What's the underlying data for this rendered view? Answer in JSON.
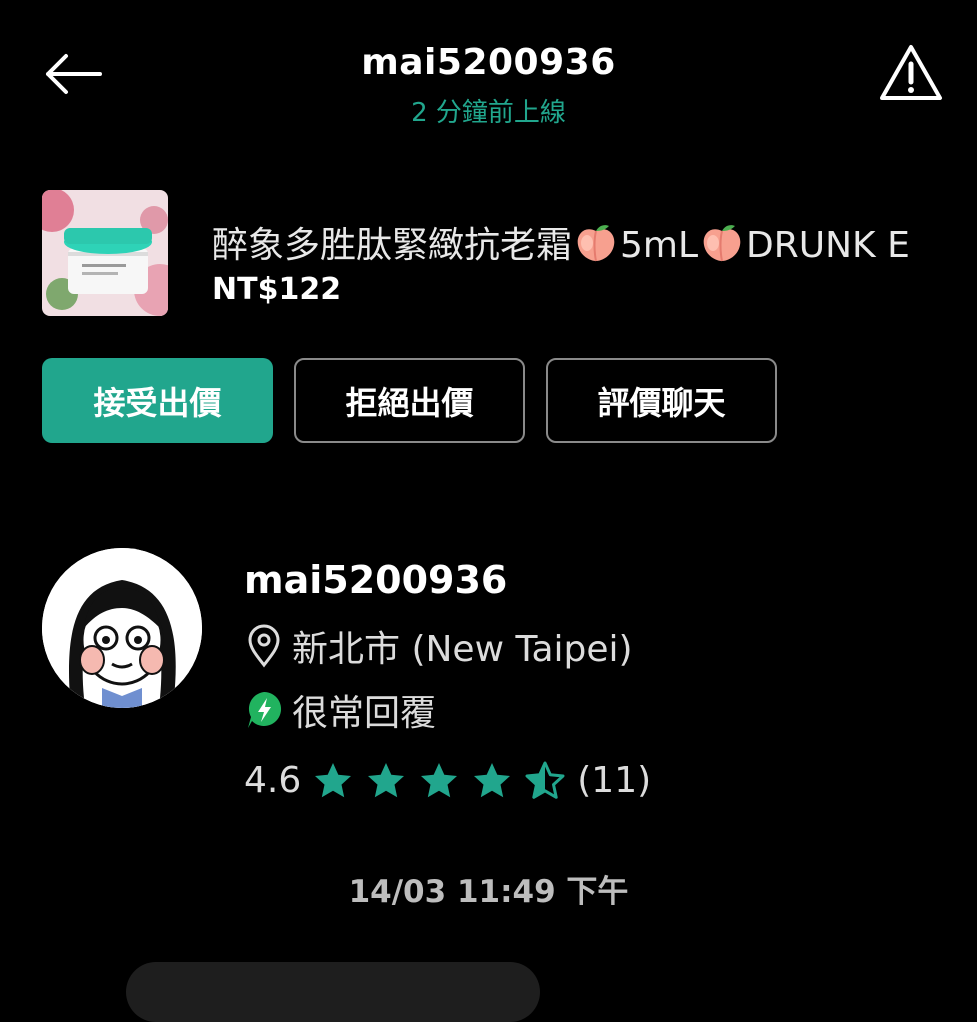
{
  "header": {
    "username": "mai5200936",
    "status": "2 分鐘前上線"
  },
  "product": {
    "title_part1": "醉象多胜肽緊緻抗老霜",
    "title_part2": "5mL",
    "title_part3": "DRUNK E",
    "price": "NT$122"
  },
  "actions": {
    "accept_label": "接受出價",
    "decline_label": "拒絕出價",
    "review_label": "評價聊天"
  },
  "seller": {
    "name": "mai5200936",
    "location": "新北市 (New Taipei)",
    "response": "很常回覆",
    "rating": "4.6",
    "rating_value": 4.6,
    "review_count": "(11)"
  },
  "chat": {
    "timestamp": "14/03 11:49 下午"
  },
  "colors": {
    "accent": "#21a68d",
    "background": "#000000",
    "outline": "#8a8a8a"
  },
  "icons": {
    "back": "arrow-left-icon",
    "report": "warning-triangle-icon",
    "location": "location-pin-icon",
    "response": "lightning-badge-icon",
    "star": "star-icon",
    "peach": "peach-emoji-icon"
  }
}
